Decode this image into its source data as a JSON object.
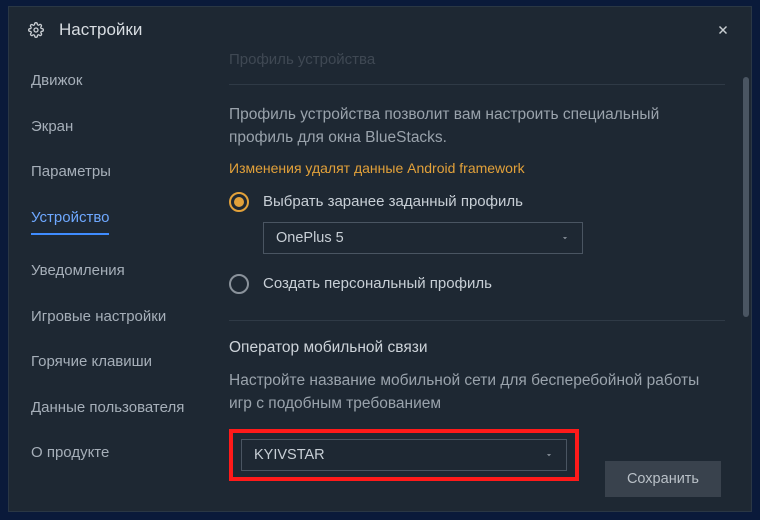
{
  "titlebar": {
    "title": "Настройки"
  },
  "sidebar": {
    "items": [
      {
        "label": "Движок"
      },
      {
        "label": "Экран"
      },
      {
        "label": "Параметры"
      },
      {
        "label": "Устройство",
        "active": true
      },
      {
        "label": "Уведомления"
      },
      {
        "label": "Игровые настройки"
      },
      {
        "label": "Горячие клавиши"
      },
      {
        "label": "Данные пользователя"
      },
      {
        "label": "О продукте"
      }
    ]
  },
  "main": {
    "faded_header": "Профиль устройства",
    "profile_desc": "Профиль устройства позволит вам настроить специальный профиль для окна BlueStacks.",
    "warning": "Изменения удалят данные Android framework",
    "radio_preset_label": "Выбрать заранее заданный профиль",
    "preset_select_value": "OnePlus 5",
    "radio_custom_label": "Создать персональный профиль",
    "operator_title": "Оператор мобильной связи",
    "operator_desc": "Настройте название мобильной сети для бесперебойной работы игр с подобным требованием",
    "operator_select_value": "KYIVSTAR",
    "save_label": "Сохранить"
  }
}
